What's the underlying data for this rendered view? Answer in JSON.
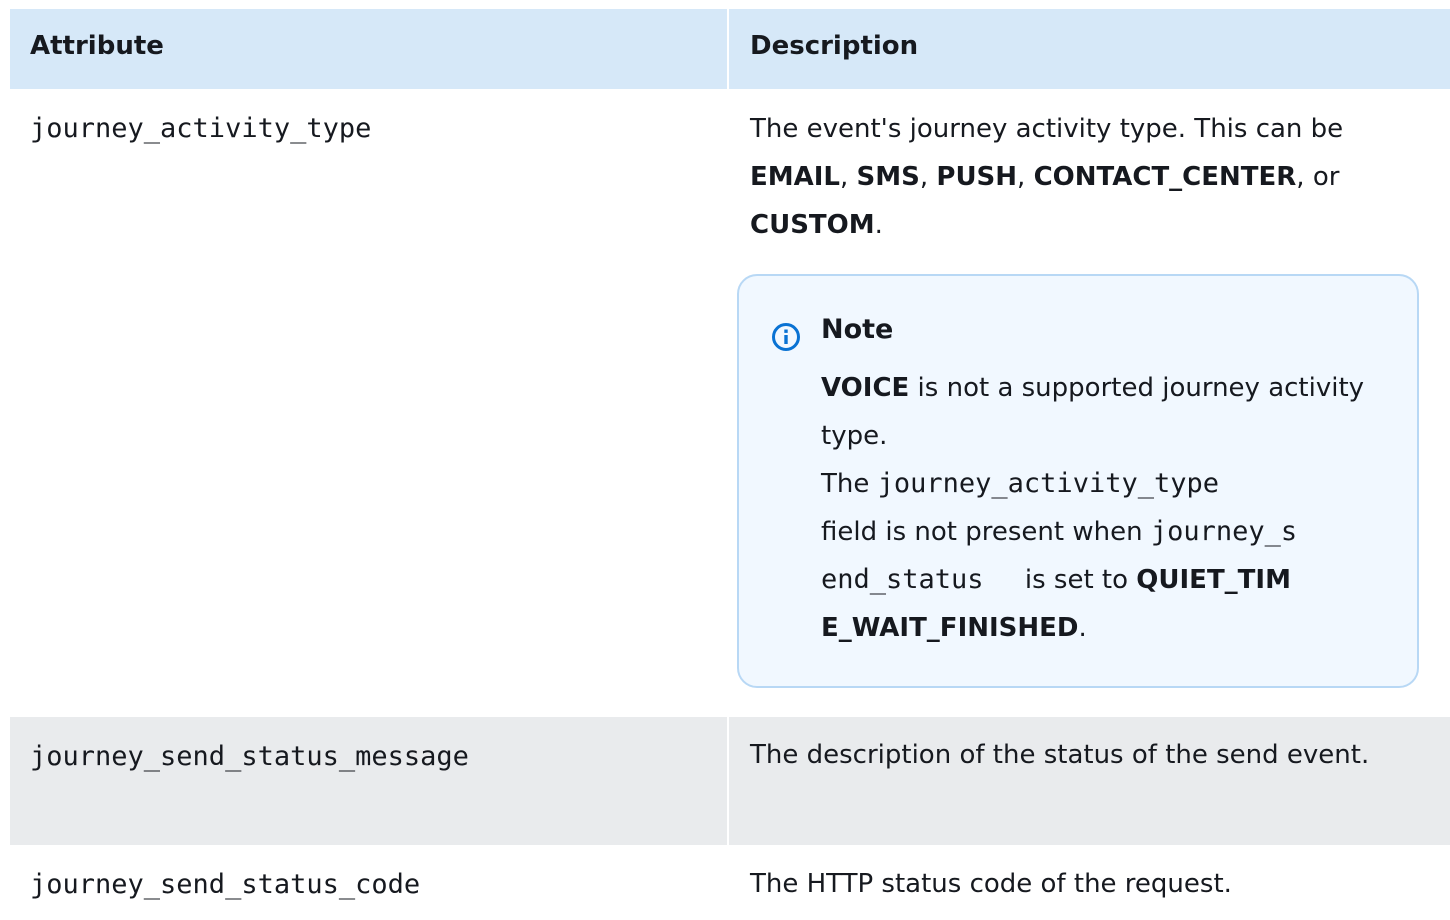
{
  "table": {
    "headers": {
      "attribute": "Attribute",
      "description": "Description"
    },
    "rows": [
      {
        "attribute": "journey_activity_type",
        "desc_intro": "The event's journey activity type. This can be ",
        "types": [
          "EMAIL",
          "SMS",
          "PUSH",
          "CONTACT_CENTER",
          "CUSTOM"
        ],
        "sep_comma": ", ",
        "sep_or": ", or ",
        "end_period": "."
      },
      {
        "attribute": "journey_send_status_message",
        "description": "The description of the status of the send event."
      },
      {
        "attribute": "journey_send_status_code",
        "description": "The HTTP status code of the request."
      }
    ]
  },
  "note": {
    "icon": "info-icon",
    "title": "Note",
    "line1_bold": "VOICE",
    "line1_rest": " is not a supported journey activity type.",
    "line2_prefix": "The ",
    "line2_code": "journey_activity_type",
    "line2_middle": " field is not present when ",
    "line2_code2_a": "journey_s",
    "line2_code2_b": "end_status",
    "line2_gap": "    ",
    "line2_after": " is set to ",
    "line2_bold_a": "QUIET_TIM",
    "line2_bold_b": "E_WAIT_FINISHED",
    "line2_end": "."
  },
  "colors": {
    "header_bg": "#d6e8f8",
    "alt_row_bg": "#e9ebed",
    "note_bg": "#f1f8ff",
    "note_border": "#b8d8f5",
    "info_icon": "#0972d3",
    "text": "#16191f"
  }
}
